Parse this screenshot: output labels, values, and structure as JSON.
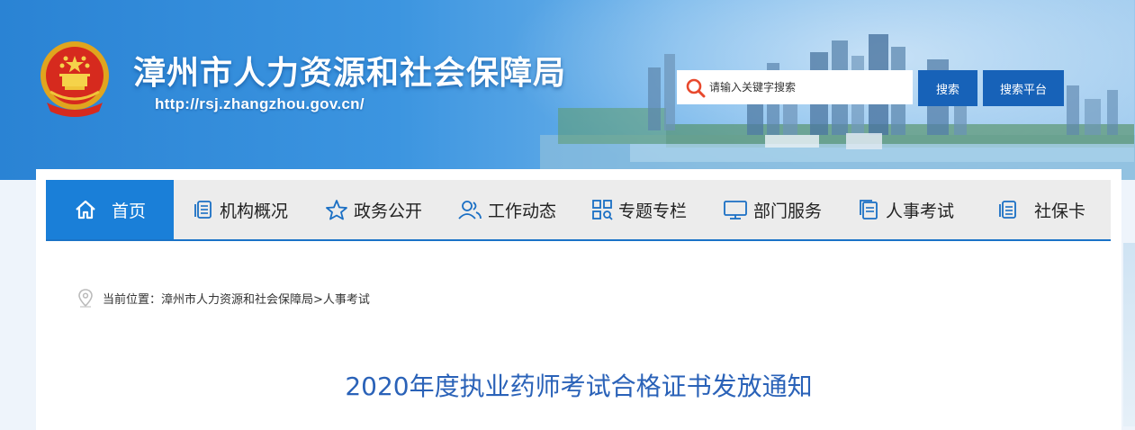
{
  "header": {
    "title": "漳州市人力资源和社会保障局",
    "url": "http://rsj.zhangzhou.gov.cn/",
    "emblem_icon": "national-emblem-icon"
  },
  "search": {
    "placeholder": "请输入关键字搜索",
    "search_button": "搜索",
    "platform_button": "搜索平台"
  },
  "nav": {
    "items": [
      {
        "label": "首页",
        "icon": "home-icon",
        "active": true
      },
      {
        "label": "机构概况",
        "icon": "document-icon"
      },
      {
        "label": "政务公开",
        "icon": "star-icon"
      },
      {
        "label": "工作动态",
        "icon": "people-icon"
      },
      {
        "label": "专题专栏",
        "icon": "grid-search-icon"
      },
      {
        "label": "部门服务",
        "icon": "monitor-icon"
      },
      {
        "label": "人事考试",
        "icon": "file-stack-icon"
      },
      {
        "label": "社保卡",
        "icon": "card-list-icon"
      }
    ]
  },
  "breadcrumb": {
    "text": "当前位置：漳州市人力资源和社会保障局>人事考试"
  },
  "article": {
    "title": "2020年度执业药师考试合格证书发放通知"
  },
  "colors": {
    "accent": "#1a7fd8",
    "button": "#1762b8",
    "title_text": "#2a62b8",
    "search_icon": "#e8492d"
  }
}
